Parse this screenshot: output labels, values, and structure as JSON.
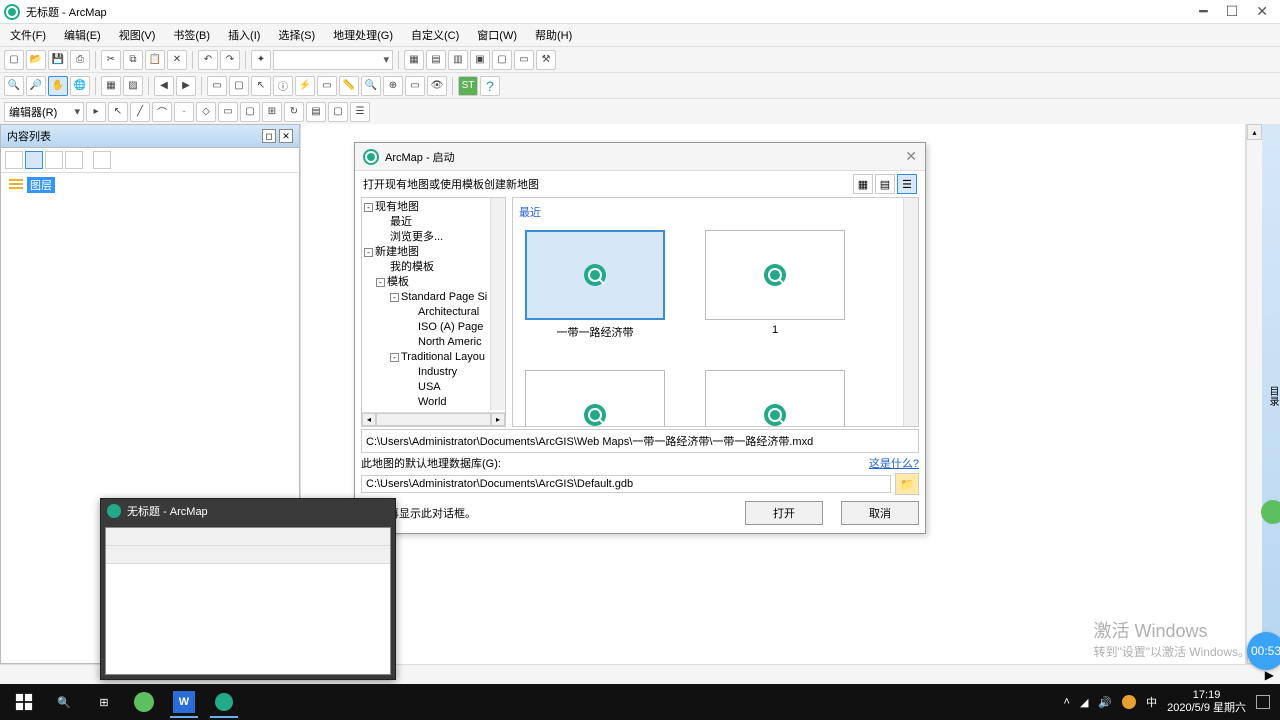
{
  "window": {
    "title": "无标题 - ArcMap"
  },
  "menu": [
    "文件(F)",
    "编辑(E)",
    "视图(V)",
    "书签(B)",
    "插入(I)",
    "选择(S)",
    "地理处理(G)",
    "自定义(C)",
    "窗口(W)",
    "帮助(H)"
  ],
  "toc": {
    "title": "内容列表",
    "root": "图层"
  },
  "dialog": {
    "title": "ArcMap - 启动",
    "subtitle": "打开现有地图或使用模板创建新地图",
    "tree": {
      "existing": "现有地图",
      "recent": "最近",
      "more": "浏览更多...",
      "newmap": "新建地图",
      "mytpl": "我的模板",
      "tpl": "模板",
      "std": "Standard Page Si",
      "arch": "Architectural",
      "iso": "ISO (A) Page",
      "na": "North Americ",
      "trad": "Traditional Layou",
      "ind": "Industry",
      "usa": "USA",
      "world": "World"
    },
    "gallery_header": "最近",
    "thumbs": [
      {
        "label": "一带一路经济带",
        "selected": true
      },
      {
        "label": "1",
        "selected": false
      },
      {
        "label": "",
        "selected": false
      },
      {
        "label": "",
        "selected": false
      }
    ],
    "path": "C:\\Users\\Administrator\\Documents\\ArcGIS\\Web Maps\\一带一路经济带\\一带一路经济带.mxd",
    "geo_label": "此地图的默认地理数据库(G):",
    "geo_link": "这是什么?",
    "geo_value": "C:\\Users\\Administrator\\Documents\\ArcGIS\\Default.gdb",
    "dont_show": "不再显示此对话框。",
    "open": "打开",
    "cancel": "取消"
  },
  "preview": {
    "title": "无标题 - ArcMap"
  },
  "watermark": {
    "l1": "激活 Windows",
    "l2": "转到\"设置\"以激活 Windows。"
  },
  "badge": "00:53",
  "taskbar": {
    "time": "17:19",
    "date": "2020/5/9 星期六",
    "ime": "中"
  },
  "editor_label": "编辑器(R)"
}
